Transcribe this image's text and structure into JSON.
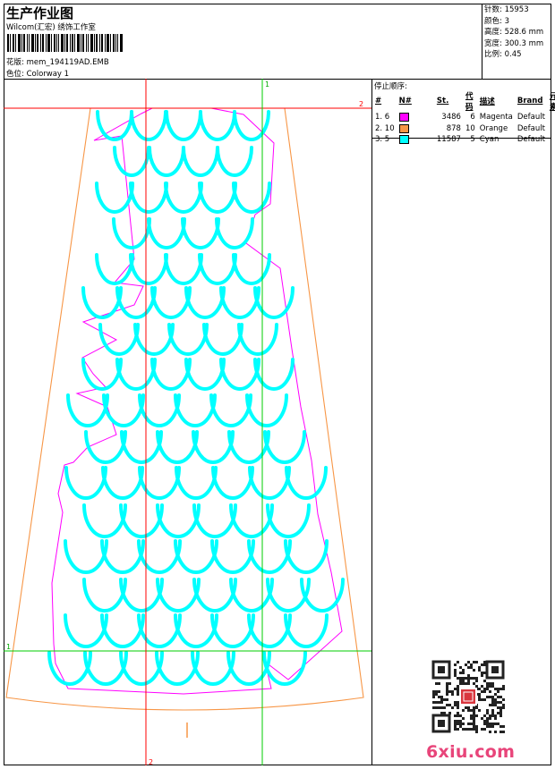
{
  "header": {
    "title": "生产作业图",
    "company": "Wilcom(汇宏) 绣饰工作室",
    "design_label": "花版:",
    "design_value": "mem_194119AD.EMB",
    "colorway_label": "色位:",
    "colorway_value": "Colorway 1"
  },
  "summary": {
    "stitches_label": "针数:",
    "stitches": "15953",
    "colors_label": "颜色:",
    "colors": "3",
    "height_label": "高度:",
    "height": "528.6 mm",
    "width_label": "宽度:",
    "width": "300.3 mm",
    "scale_label": "比例:",
    "scale": "0.45"
  },
  "legend": {
    "title": "停止顺序:",
    "headers": [
      "#",
      "N#",
      "St.",
      "代码",
      "描述",
      "Brand",
      "元素"
    ],
    "rows": [
      {
        "n": "1. 6",
        "color": "#ff00ff",
        "stitches": "3486",
        "code": "6",
        "desc": "Magenta",
        "brand": "Default"
      },
      {
        "n": "2. 10",
        "color": "#f79646",
        "stitches": "878",
        "code": "10",
        "desc": "Orange",
        "brand": "Default"
      },
      {
        "n": "3. 5",
        "color": "#00ffff",
        "stitches": "11587",
        "code": "5",
        "desc": "Cyan",
        "brand": "Default"
      }
    ]
  },
  "guides": {
    "top_label": "1",
    "right_label": "2",
    "bottom_label": "2",
    "left_label": "1"
  },
  "colors": {
    "cyan": "#00ffff",
    "magenta": "#ff00ff",
    "orange": "#f79646",
    "guide_red": "#ff0000",
    "guide_green": "#00cc00",
    "brand": "#e8457a"
  },
  "watermark": {
    "site": "6xiu.com"
  }
}
